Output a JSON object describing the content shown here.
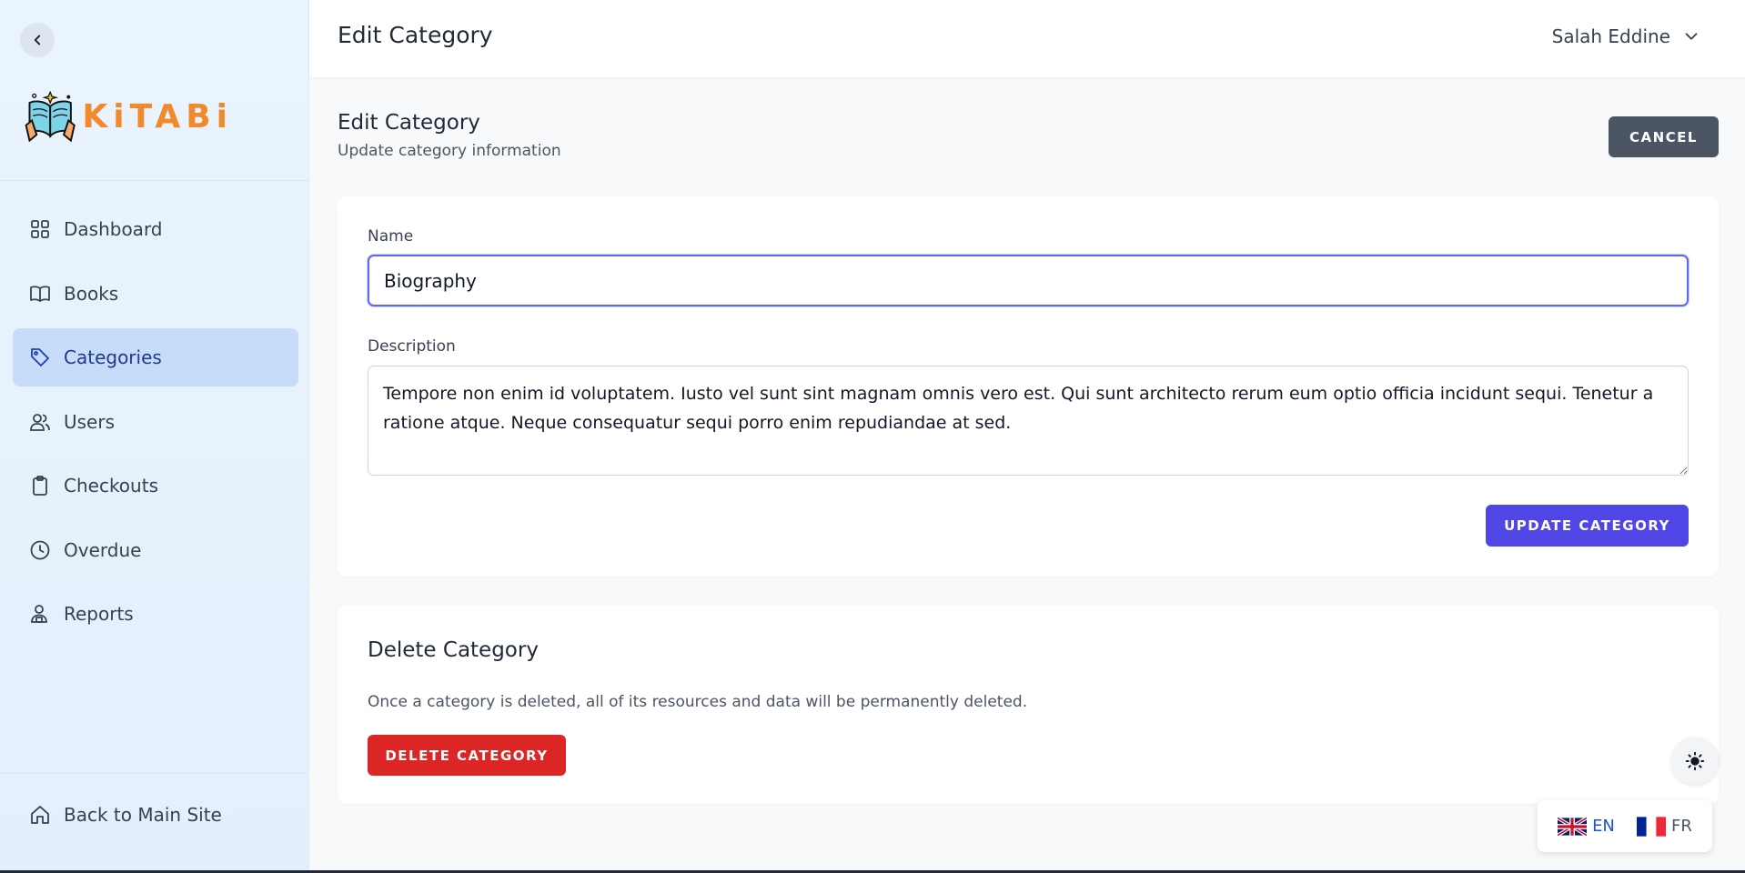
{
  "app": {
    "brand": "KiTABi",
    "brand_color": "#f08a2c",
    "accent": "#4f46e5",
    "danger": "#dc2626"
  },
  "topbar": {
    "title": "Edit Category",
    "user_name": "Salah Eddine"
  },
  "sidebar": {
    "items": [
      {
        "label": "Dashboard",
        "icon": "grid-icon",
        "active": false
      },
      {
        "label": "Books",
        "icon": "book-icon",
        "active": false
      },
      {
        "label": "Categories",
        "icon": "tag-icon",
        "active": true
      },
      {
        "label": "Users",
        "icon": "users-icon",
        "active": false
      },
      {
        "label": "Checkouts",
        "icon": "clipboard-icon",
        "active": false
      },
      {
        "label": "Overdue",
        "icon": "clock-icon",
        "active": false
      },
      {
        "label": "Reports",
        "icon": "user-report-icon",
        "active": false
      }
    ],
    "back_to_main": "Back to Main Site"
  },
  "page": {
    "title": "Edit Category",
    "subtitle": "Update category information",
    "cancel_label": "CANCEL"
  },
  "form": {
    "name_label": "Name",
    "name_value": "Biography",
    "description_label": "Description",
    "description_value": "Tempore non enim id voluptatem. Iusto vel sunt sint magnam omnis vero est. Qui sunt architecto rerum eum optio officia incidunt sequi. Tenetur a ratione atque. Neque consequatur sequi porro enim repudiandae at sed.",
    "update_label": "UPDATE CATEGORY"
  },
  "delete": {
    "title": "Delete Category",
    "text": "Once a category is deleted, all of its resources and data will be permanently deleted.",
    "button_label": "DELETE CATEGORY"
  },
  "languages": [
    {
      "code": "EN",
      "active": true
    },
    {
      "code": "FR",
      "active": false
    }
  ]
}
